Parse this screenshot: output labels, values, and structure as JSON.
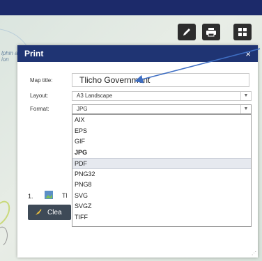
{
  "map": {
    "label_line1": "lphin and",
    "label_line2": "ion"
  },
  "toolbar": {
    "icons": [
      "pencil-icon",
      "printer-icon",
      "grid-icon"
    ]
  },
  "panel": {
    "title": "Print",
    "close_label": "×",
    "map_title_label": "Map title:",
    "map_title_value": "Tlicho Government",
    "layout_label": "Layout:",
    "layout_value": "A3 Landscape",
    "format_label": "Format:",
    "format_value": "JPG",
    "format_options": [
      "AIX",
      "EPS",
      "GIF",
      "JPG",
      "PDF",
      "PNG32",
      "PNG8",
      "SVG",
      "SVGZ",
      "TIFF"
    ],
    "highlighted_option": "PDF",
    "result_number": "1.",
    "result_text": "Tl",
    "clear_label": "Clea"
  },
  "colors": {
    "header": "#1f3473",
    "topbar": "#1c2a6a",
    "button": "#3e4a57",
    "arrow": "#3f6fc4"
  }
}
